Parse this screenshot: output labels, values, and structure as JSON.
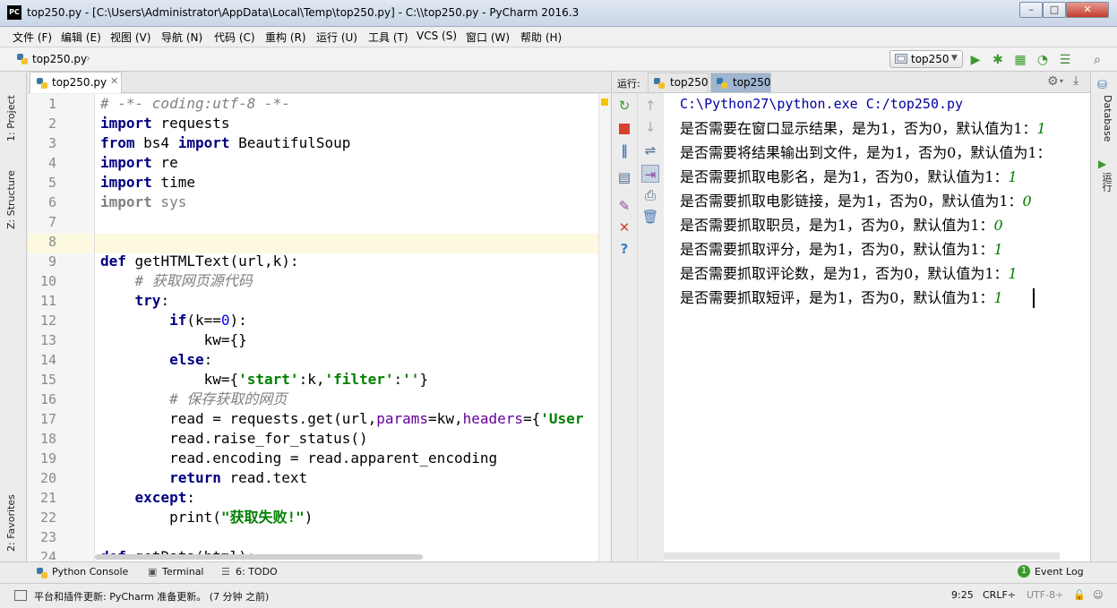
{
  "window": {
    "title": "top250.py - [C:\\Users\\Administrator\\AppData\\Local\\Temp\\top250.py] - C:\\\\top250.py - PyCharm 2016.3",
    "app_icon_text": "PC",
    "controls": {
      "minimize": "–",
      "maximize": "□",
      "close": "✕"
    }
  },
  "menu": [
    "文件 (F)",
    "编辑 (E)",
    "视图 (V)",
    "导航 (N)",
    "代码 (C)",
    "重构 (R)",
    "运行 (U)",
    "工具 (T)",
    "VCS (S)",
    "窗口 (W)",
    "帮助 (H)"
  ],
  "navbar": {
    "file": "top250.py",
    "run_config": "top250"
  },
  "left_stripe": {
    "project": "1: Project",
    "structure": "Z: Structure",
    "favorites": "2: Favorites"
  },
  "editor": {
    "tab_label": "top250.py",
    "line_numbers": [
      "1",
      "2",
      "3",
      "4",
      "5",
      "6",
      "7",
      "8",
      "9",
      "10",
      "11",
      "12",
      "13",
      "14",
      "15",
      "16",
      "17",
      "18",
      "19",
      "20",
      "21",
      "22",
      "23",
      "24"
    ]
  },
  "run_panel": {
    "label": "运行:",
    "tabs": [
      "top250",
      "top250"
    ],
    "console": {
      "command": "C:\\Python27\\python.exe C:/top250.py",
      "lines": [
        {
          "prompt": "是否需要在窗口显示结果，是为1，否为0，默认值为1：",
          "input": "1"
        },
        {
          "prompt": "是否需要将结果输出到文件，是为1，否为0，默认值为1：",
          "input": ""
        },
        {
          "prompt": "是否需要抓取电影名，是为1，否为0，默认值为1：",
          "input": "1"
        },
        {
          "prompt": "是否需要抓取电影链接，是为1，否为0，默认值为1：",
          "input": "0"
        },
        {
          "prompt": "是否需要抓取职员，是为1，否为0，默认值为1：",
          "input": "0"
        },
        {
          "prompt": "是否需要抓取评分，是为1，否为0，默认值为1：",
          "input": "1"
        },
        {
          "prompt": "是否需要抓取评论数，是为1，否为0，默认值为1：",
          "input": "1"
        },
        {
          "prompt": "是否需要抓取短评，是为1，否为0，默认值为1：",
          "input": "1"
        }
      ]
    }
  },
  "right_stripe": {
    "database": "Database",
    "run": "运行"
  },
  "bottom_tools": {
    "python_console": "Python Console",
    "terminal": "Terminal",
    "todo": "6: TODO",
    "event_log_count": "1",
    "event_log": "Event Log"
  },
  "status": {
    "message": "平台和插件更新: PyCharm 准备更新。 (7 分钟 之前)",
    "position": "9:25",
    "line_sep": "CRLF÷",
    "encoding": "UTF-8÷"
  }
}
